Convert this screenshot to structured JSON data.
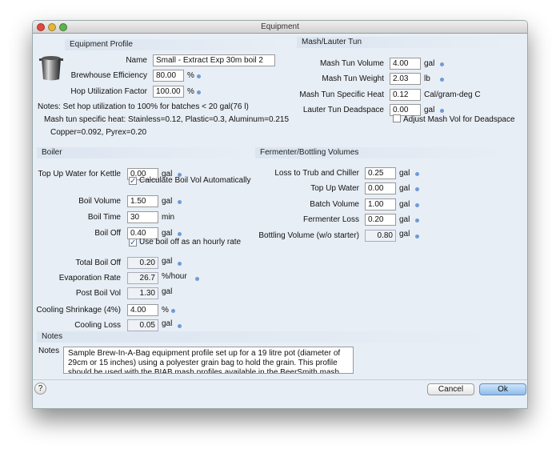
{
  "window": {
    "title": "Equipment"
  },
  "profile": {
    "header": "Equipment Profile",
    "icon": "pot-icon",
    "name_label": "Name",
    "name_value": "Small - Extract Exp 30m boil 2",
    "efficiency_label": "Brewhouse Efficiency",
    "efficiency_value": "80.00",
    "efficiency_unit": "%",
    "hop_label": "Hop Utilization Factor",
    "hop_value": "100.00",
    "hop_unit": "%",
    "note1": "Notes: Set hop utilization to 100% for batches < 20 gal(76 l)",
    "note2": "Mash tun specific heat: Stainless=0.12, Plastic=0.3, Aluminum=0.215",
    "note3": "Copper=0.092, Pyrex=0.20"
  },
  "mash": {
    "header": "Mash/Lauter Tun",
    "rows": [
      {
        "label": "Mash Tun Volume",
        "value": "4.00",
        "unit": "gal"
      },
      {
        "label": "Mash Tun Weight",
        "value": "2.03",
        "unit": "lb"
      },
      {
        "label": "Mash Tun Specific Heat",
        "value": "0.12",
        "unit": "Cal/gram-deg C"
      },
      {
        "label": "Lauter Tun Deadspace",
        "value": "0.00",
        "unit": "gal"
      }
    ],
    "adjust_label": "Adjust Mash Vol for Deadspace",
    "adjust_checked": false
  },
  "boiler": {
    "header": "Boiler",
    "topup_label": "Top Up Water for Kettle",
    "topup_value": "0.00",
    "topup_unit": "gal",
    "calc_label": "Calculate Boil Vol Automatically",
    "calc_checked": true,
    "boilvol_label": "Boil Volume",
    "boilvol_value": "1.50",
    "boilvol_unit": "gal",
    "boiltime_label": "Boil Time",
    "boiltime_value": "30",
    "boiltime_unit": "min",
    "boiloff_label": "Boil Off",
    "boiloff_value": "0.40",
    "boiloff_unit": "gal",
    "hourly_label": "Use boil off as an hourly rate",
    "hourly_checked": true,
    "total_label": "Total Boil Off",
    "total_value": "0.20",
    "total_unit": "gal",
    "evap_label": "Evaporation Rate",
    "evap_value": "26.7",
    "evap_unit": "%/hour",
    "post_label": "Post Boil Vol",
    "post_value": "1.30",
    "post_unit": "gal",
    "shrink_label": "Cooling Shrinkage (4%)",
    "shrink_value": "4.00",
    "shrink_unit": "%",
    "coolloss_label": "Cooling Loss",
    "coolloss_value": "0.05",
    "coolloss_unit": "gal"
  },
  "fermenter": {
    "header": "Fermenter/Bottling Volumes",
    "rows": [
      {
        "label": "Loss to Trub and Chiller",
        "value": "0.25",
        "unit": "gal"
      },
      {
        "label": "Top Up Water",
        "value": "0.00",
        "unit": "gal"
      },
      {
        "label": "Batch Volume",
        "value": "1.00",
        "unit": "gal"
      },
      {
        "label": "Fermenter Loss",
        "value": "0.20",
        "unit": "gal"
      },
      {
        "label": "Bottling Volume (w/o starter)",
        "value": "0.80",
        "unit": "gal"
      }
    ]
  },
  "notes": {
    "header": "Notes",
    "label": "Notes",
    "text": "Sample Brew-In-A-Bag equipment profile set up for a 19 litre pot (diameter of 29cm or 15 inches) using a polyester grain bag to hold the grain.  This profile should be used with the BIAB mash profiles available in the BeerSmith mash"
  },
  "footer": {
    "help": "?",
    "cancel": "Cancel",
    "ok": "Ok"
  },
  "colors": {
    "accent": "#6e9bd6",
    "ok_button": "#a9ccf0"
  }
}
